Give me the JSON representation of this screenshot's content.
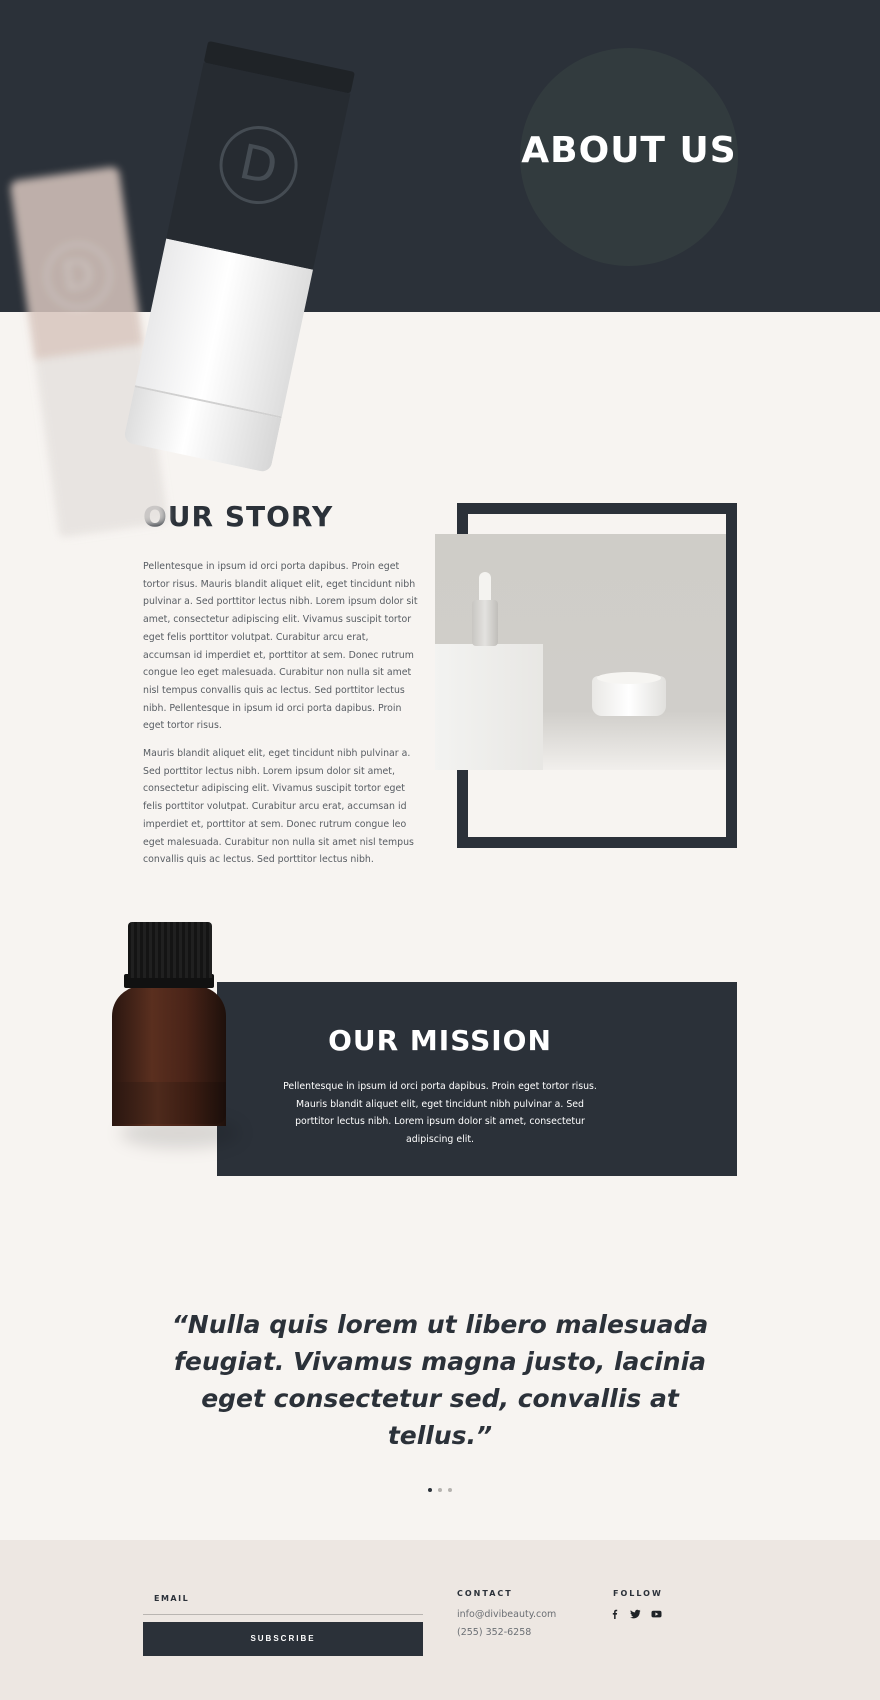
{
  "hero": {
    "title": "ABOUT US"
  },
  "story": {
    "title": "OUR STORY",
    "paragraphs": [
      "Pellentesque in ipsum id orci porta dapibus. Proin eget tortor risus. Mauris blandit aliquet elit, eget tincidunt nibh pulvinar a. Sed porttitor lectus nibh. Lorem ipsum dolor sit amet, consectetur adipiscing elit. Vivamus suscipit tortor eget felis porttitor volutpat. Curabitur arcu erat, accumsan id imperdiet et, porttitor at sem. Donec rutrum congue leo eget malesuada. Curabitur non nulla sit amet nisl tempus convallis quis ac lectus. Sed porttitor lectus nibh.  Pellentesque in ipsum id orci porta dapibus. Proin eget tortor risus.",
      "Mauris blandit aliquet elit, eget tincidunt nibh pulvinar a. Sed porttitor lectus nibh. Lorem ipsum dolor sit amet, consectetur adipiscing elit. Vivamus suscipit tortor eget felis porttitor volutpat. Curabitur arcu erat, accumsan id imperdiet et, porttitor at sem. Donec rutrum congue leo eget malesuada. Curabitur non nulla sit amet nisl tempus convallis quis ac lectus. Sed porttitor lectus nibh."
    ]
  },
  "mission": {
    "title": "OUR MISSION",
    "text": "Pellentesque in ipsum id orci porta dapibus. Proin eget tortor risus. Mauris blandit aliquet elit, eget tincidunt nibh pulvinar a. Sed porttitor lectus nibh. Lorem ipsum dolor sit amet, consectetur adipiscing elit."
  },
  "testimonial": {
    "quote": "“Nulla quis lorem ut libero malesuada feugiat. Vivamus magna justo, lacinia eget consectetur sed, convallis at tellus.”",
    "slider_dots": 3,
    "active_dot": 1
  },
  "footer": {
    "email_label": "EMAIL",
    "subscribe_label": "SUBSCRIBE",
    "contact_title": "CONTACT",
    "contact_email": "info@divibeauty.com",
    "contact_phone": "(255) 352-6258",
    "follow_title": "FOLLOW",
    "social_icons": [
      "facebook-icon",
      "twitter-icon",
      "youtube-icon"
    ]
  },
  "brand": {
    "logo_letter": "D"
  },
  "colors": {
    "dark": "#2b3139",
    "background": "#f7f4f1",
    "footer": "#ede7e2",
    "accent_circle": "#323b3e"
  }
}
